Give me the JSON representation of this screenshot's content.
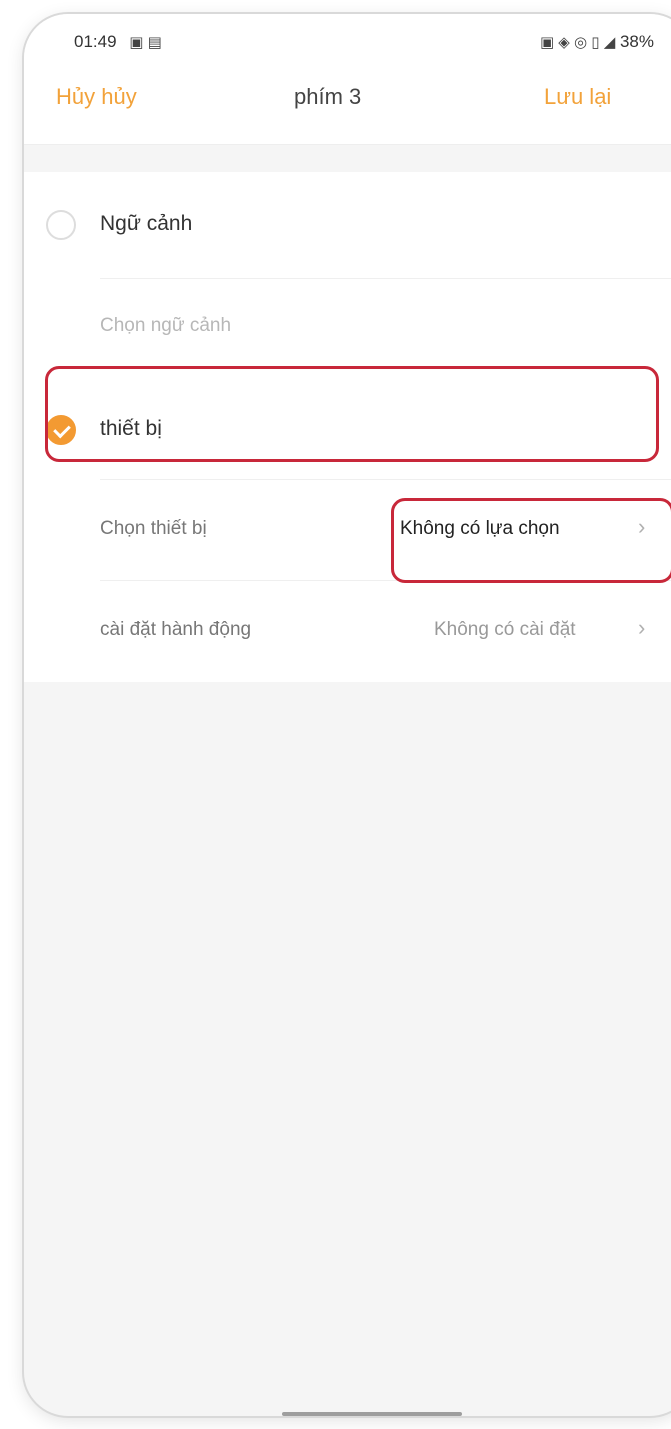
{
  "status_bar": {
    "time": "01:49",
    "left_icons": "▣ ▤",
    "right_icons": "▣ ◈ ◎ ▯ ◢",
    "battery": "38%"
  },
  "nav": {
    "cancel_label": "Hủy hủy",
    "title": "phím 3",
    "save_label": "Lưu lại"
  },
  "options": {
    "scene": {
      "label": "Ngữ cảnh",
      "select_label": "Chọn ngữ cảnh",
      "selected": false
    },
    "device": {
      "label": "thiết bị",
      "selected": true,
      "select_label": "Chọn thiết bị",
      "select_value": "Không có lựa chọn",
      "action_label": "cài đặt hành động",
      "action_value": "Không có cài đặt"
    }
  },
  "icons": {
    "chevron": "›",
    "radio_checked_color": "#f39a32",
    "accent": "#f2a23a",
    "highlight": "#c8283a"
  }
}
